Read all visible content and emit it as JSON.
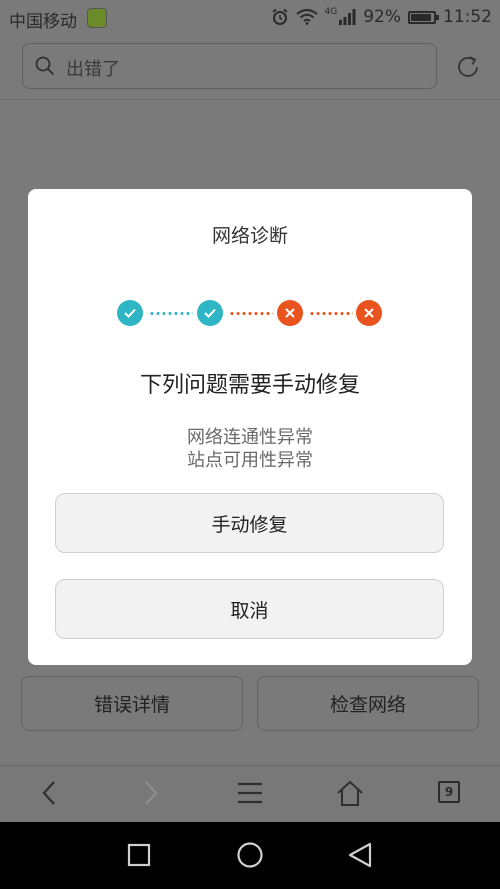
{
  "status_bar": {
    "carrier": "中国移动",
    "network_type": "4G",
    "battery_percent": "92%",
    "battery_level": 0.92,
    "time": "11:52"
  },
  "address_bar": {
    "text": "出错了"
  },
  "dialog": {
    "title": "网络诊断",
    "steps": [
      {
        "status": "ok",
        "icon": "check-icon"
      },
      {
        "status": "ok",
        "icon": "check-icon"
      },
      {
        "status": "error",
        "icon": "x-icon"
      },
      {
        "status": "error",
        "icon": "x-icon"
      }
    ],
    "heading": "下列问题需要手动修复",
    "issues": [
      "网络连通性异常",
      "站点可用性异常"
    ],
    "primary_button": "手动修复",
    "cancel_button": "取消"
  },
  "page_buttons": {
    "error_details": "错误详情",
    "check_network": "检查网络"
  },
  "toolbar": {
    "tab_count": "9"
  },
  "colors": {
    "ok": "#2fb6c5",
    "error": "#e9531d"
  }
}
